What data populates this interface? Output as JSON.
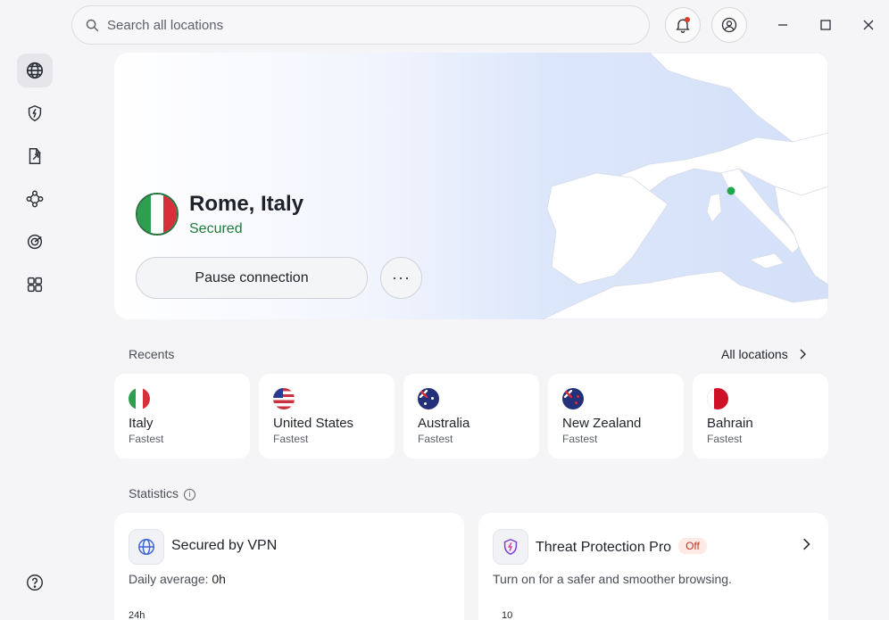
{
  "search": {
    "placeholder": "Search all locations"
  },
  "sidebar": {
    "items": [
      {
        "icon": "globe-icon",
        "active": true
      },
      {
        "icon": "shield-bolt-icon"
      },
      {
        "icon": "file-share-icon"
      },
      {
        "icon": "meshnet-icon"
      },
      {
        "icon": "target-icon"
      },
      {
        "icon": "apps-grid-icon"
      }
    ],
    "help_icon": "help-icon"
  },
  "connection": {
    "location": "Rome, Italy",
    "status": "Secured",
    "pause_label": "Pause connection",
    "more_label": "···",
    "status_color": "#1f7a3c"
  },
  "recents": {
    "heading": "Recents",
    "all_label": "All locations",
    "items": [
      {
        "country": "Italy",
        "server": "Fastest"
      },
      {
        "country": "United States",
        "server": "Fastest"
      },
      {
        "country": "Australia",
        "server": "Fastest"
      },
      {
        "country": "New Zealand",
        "server": "Fastest"
      },
      {
        "country": "Bahrain",
        "server": "Fastest"
      }
    ]
  },
  "statistics": {
    "heading": "Statistics",
    "info": "i",
    "vpn": {
      "title": "Secured by VPN",
      "avg_label": "Daily average: ",
      "avg_value": "0h",
      "axis_top": "24h"
    },
    "threat": {
      "title": "Threat Protection Pro",
      "badge": "Off",
      "description": "Turn on for a safer and smoother browsing.",
      "axis_top": "10"
    }
  },
  "colors": {
    "accent": "#1f7a3c",
    "off_badge": "#c1351f",
    "map_land": "#ffffff",
    "map_sea": "#d3e0f8"
  }
}
